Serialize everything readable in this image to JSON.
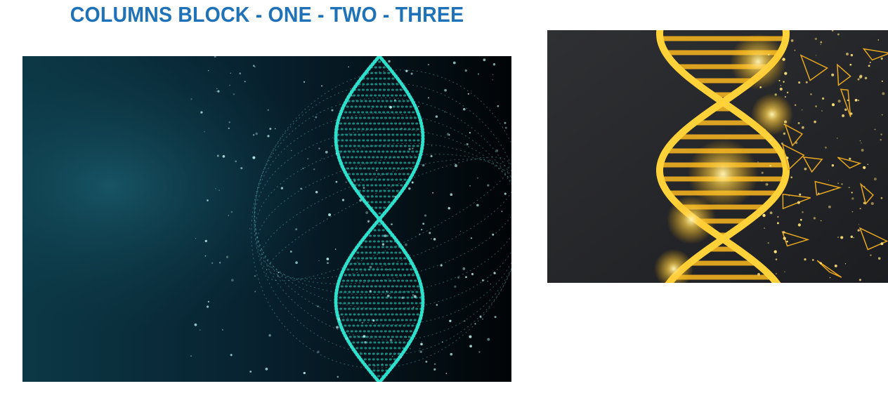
{
  "block": {
    "title": "COLUMNS BLOCK - ONE - TWO - THREE"
  },
  "columns": [
    {
      "image_icon": "teal-dna-helix-image",
      "theme_color": "#2ee0cc",
      "background_color": "#0a2a35"
    },
    {
      "image_icon": "gold-dna-helix-image",
      "theme_color": "#ffc93a",
      "background_color": "#2b2c2f"
    }
  ],
  "colors": {
    "title": "#1f72b8"
  }
}
